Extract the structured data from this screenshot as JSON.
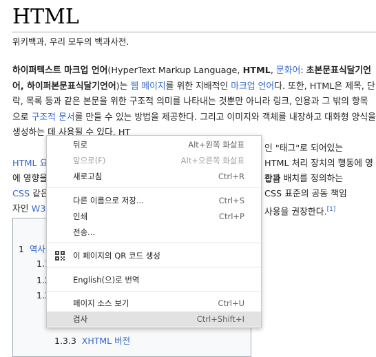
{
  "article": {
    "title": "HTML",
    "subtitle": "위키백과, 우리 모두의 백과사전.",
    "p1": {
      "t1": "하이퍼텍스트 마크업 언어",
      "t2": "(HyperText Markup Language, ",
      "t3": "HTML",
      "t4": ", ",
      "link_munhwa": "문화어",
      "t5": ": ",
      "t6": "초본문표식달기언어, 하이퍼본문표식달기언어",
      "t7": ")는 ",
      "link_webpage": "웹 페이지",
      "t8": "를 위한 지배적인 ",
      "link_markup": "마크업 언어",
      "t9": "다. 또한, HTML은 제목, 단락, 목록 등과 같은 본문을 위한 구조적 의미를 나타내는 것뿐만 아니라 링크, 인용과 그 밖의 항목으로 ",
      "link_struct": "구조적 문서",
      "t10": "를 만들 수 있는 방법을 제공한다. 그리고 이미지와 객체를 내장하고 대화형 양식을 생성하는 데 사용될 수 있다. HT",
      "t11": "인 \"태그\"로 되어있는",
      "link_html": "HTML 요",
      "t12": "HTML 처리 장치의 행동에 영향을",
      "t13": "관과 배치를 정의하는",
      "link_css": "CSS",
      "t14": "같은",
      "t15": "CSS 표준의 공동 책임자인 W3",
      "t16": "사용을 권장한다.",
      "ref": "[1]"
    }
  },
  "toc": {
    "items": [
      {
        "num": "1",
        "text": "역사"
      },
      {
        "num": "1.1",
        "text": ""
      },
      {
        "num": "1.2",
        "text": ""
      },
      {
        "num": "1.3",
        "text": ""
      },
      {
        "num": "1.3.3",
        "text": "XHTML 버전"
      }
    ]
  },
  "context_menu": {
    "items": [
      {
        "label": "뒤로",
        "shortcut": "Alt+왼쪽 화살표",
        "enabled": true
      },
      {
        "label": "앞으로(F)",
        "shortcut": "Alt+오른쪽 화살표",
        "enabled": false
      },
      {
        "label": "새로고침",
        "shortcut": "Ctrl+R",
        "enabled": true
      },
      {
        "label": "다른 이름으로 저장...",
        "shortcut": "Ctrl+S",
        "enabled": true
      },
      {
        "label": "인쇄",
        "shortcut": "Ctrl+P",
        "enabled": true
      },
      {
        "label": "전송...",
        "shortcut": "",
        "enabled": true
      },
      {
        "label": "이 페이지의 QR 코드 생성",
        "shortcut": "",
        "enabled": true,
        "icon": "qr-code-icon"
      },
      {
        "label": "English(으)로 번역",
        "shortcut": "",
        "enabled": true
      },
      {
        "label": "페이지 소스 보기",
        "shortcut": "Ctrl+U",
        "enabled": true
      },
      {
        "label": "검사",
        "shortcut": "Ctrl+Shift+I",
        "enabled": true,
        "highlighted": true
      }
    ]
  },
  "colors": {
    "link": "#3366cc",
    "text": "#202122",
    "menu_hover": "#e2e2e2",
    "disabled": "#a0a0a0"
  }
}
